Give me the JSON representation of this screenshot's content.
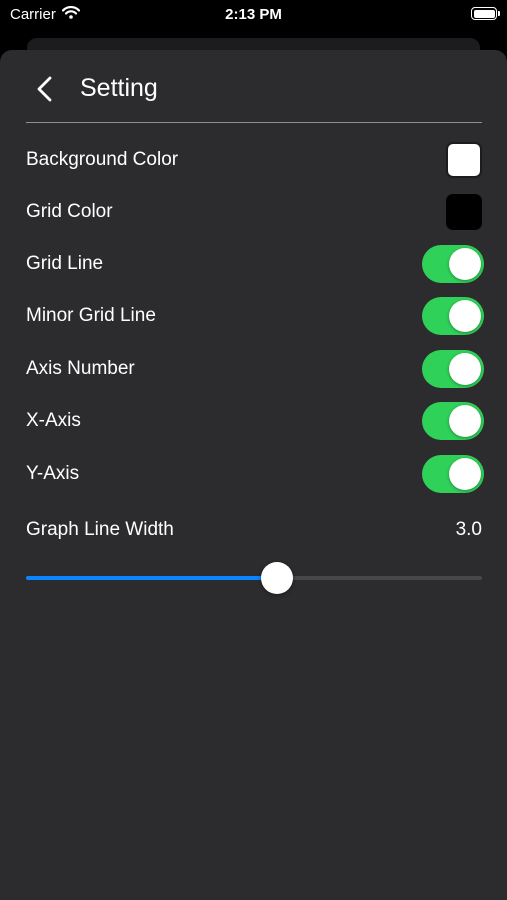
{
  "status_bar": {
    "carrier": "Carrier",
    "wifi_icon": "wifi-icon",
    "time": "2:13 PM",
    "battery_icon": "battery-icon"
  },
  "header": {
    "back_icon": "chevron-left-icon",
    "title": "Setting"
  },
  "settings": {
    "background_color": {
      "label": "Background Color",
      "color": "#ffffff"
    },
    "grid_color": {
      "label": "Grid Color",
      "color": "#000000"
    },
    "toggles": [
      {
        "label": "Grid Line",
        "on": true
      },
      {
        "label": "Minor Grid Line",
        "on": true
      },
      {
        "label": "Axis Number",
        "on": true
      },
      {
        "label": "X-Axis",
        "on": true
      },
      {
        "label": "Y-Axis",
        "on": true
      }
    ],
    "line_width": {
      "label": "Graph Line Width",
      "value_text": "3.0",
      "slider_fraction": 0.55
    }
  },
  "colors": {
    "sheet_background": "#2c2c2e",
    "toggle_on": "#30d158",
    "slider_accent": "#0a84ff"
  }
}
